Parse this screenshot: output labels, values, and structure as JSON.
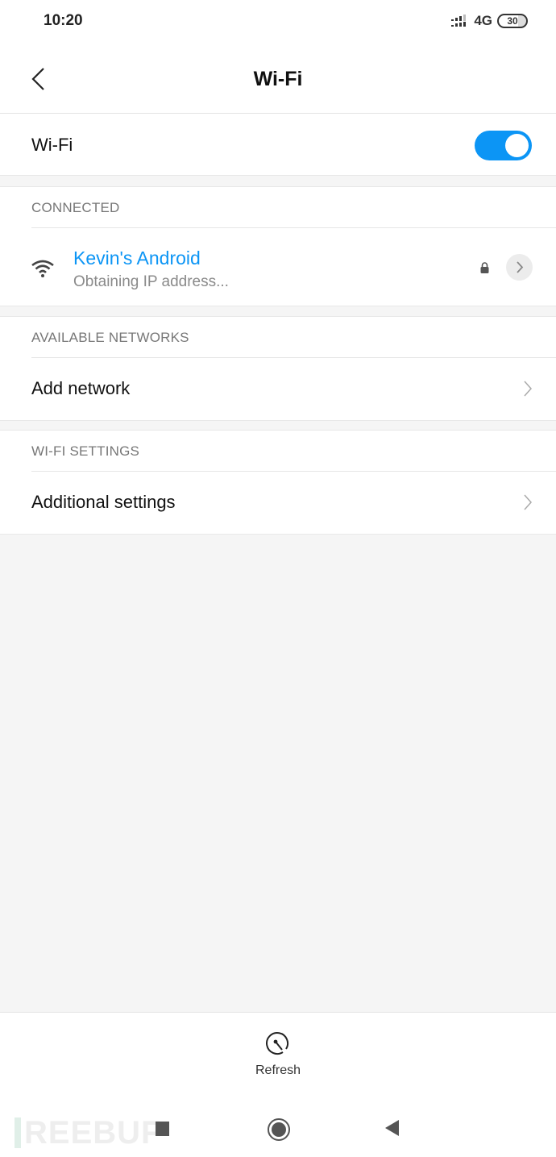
{
  "status_bar": {
    "time": "10:20",
    "network": "4G",
    "battery": "30",
    "icons": [
      "signal-icon",
      "battery-icon"
    ]
  },
  "header": {
    "title": "Wi-Fi",
    "back_icon": "chevron-left-icon"
  },
  "wifi_toggle": {
    "label": "Wi-Fi",
    "enabled": true,
    "accent_color": "#0c95f5"
  },
  "connected": {
    "section_title": "CONNECTED",
    "network": {
      "name": "Kevin's Android",
      "status": "Obtaining IP address...",
      "secured": true,
      "icons": [
        "wifi-signal-icon",
        "lock-icon",
        "chevron-right-icon"
      ]
    }
  },
  "available_networks": {
    "section_title": "AVAILABLE NETWORKS",
    "items": [
      {
        "label": "Add network"
      }
    ]
  },
  "wifi_settings": {
    "section_title": "WI-FI SETTINGS",
    "items": [
      {
        "label": "Additional settings"
      }
    ]
  },
  "bottom_action": {
    "label": "Refresh",
    "icon": "refresh-icon"
  },
  "nav_bar": {
    "buttons": [
      "recents",
      "home",
      "back"
    ]
  },
  "watermark": {
    "text": "REEBUF"
  }
}
